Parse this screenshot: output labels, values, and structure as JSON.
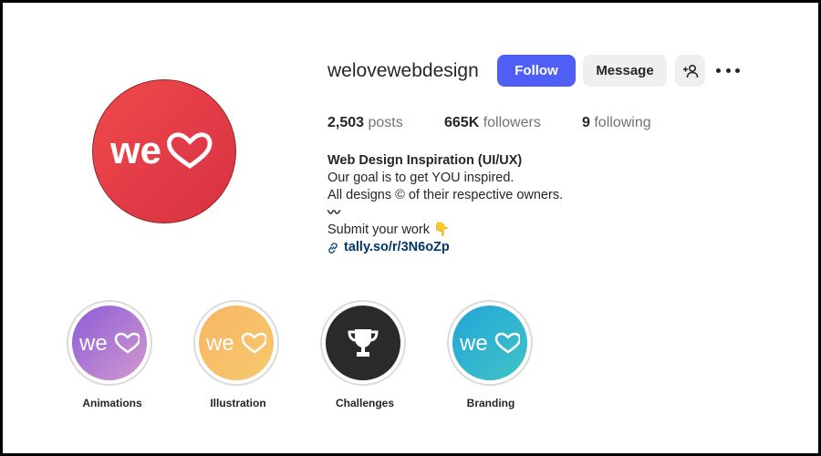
{
  "profile": {
    "username": "welovewebdesign",
    "avatar_text": "we",
    "buttons": {
      "follow": "Follow",
      "message": "Message"
    },
    "stats": {
      "posts_count": "2,503",
      "posts_label": "posts",
      "followers_count": "665K",
      "followers_label": "followers",
      "following_count": "9",
      "following_label": "following"
    },
    "bio": {
      "name": "Web Design Inspiration (UI/UX)",
      "line1": "Our goal is to get YOU inspired.",
      "line2": "All designs © of their respective owners.",
      "squiggle": "〰",
      "line3": "Submit your work 👇",
      "link": "tally.so/r/3N6oZp"
    }
  },
  "highlights": [
    {
      "label": "Animations",
      "text": "we",
      "colors": [
        "#8d5bd6",
        "#d29ad0"
      ]
    },
    {
      "label": "Illustration",
      "text": "we",
      "colors": [
        "#f7b562",
        "#f7c96f"
      ]
    },
    {
      "label": "Challenges",
      "icon": "trophy-icon",
      "colors": [
        "#2a2a2a",
        "#2a2a2a"
      ]
    },
    {
      "label": "Branding",
      "text": "we",
      "colors": [
        "#23a5d8",
        "#40c4c6"
      ]
    }
  ],
  "colors": {
    "follow_button": "#4f5ff6",
    "link": "#00376b",
    "avatar": "#e23b48"
  }
}
